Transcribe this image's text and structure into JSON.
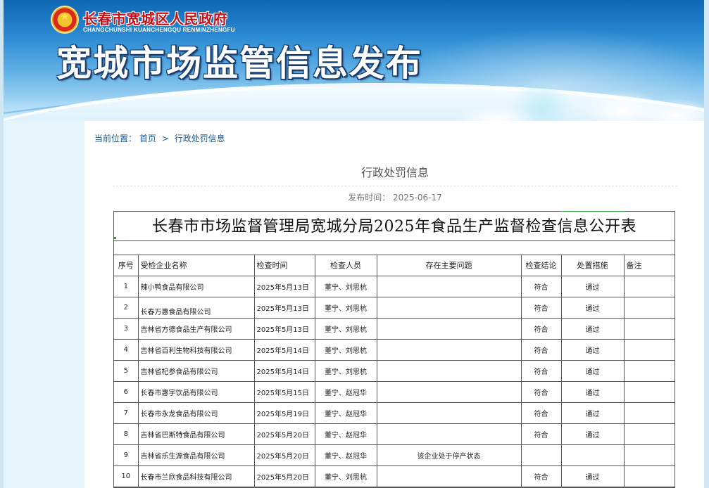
{
  "header": {
    "site_name": "长春市宽城区人民政府",
    "site_pinyin": "CHANGCHUNSHI KUANCHENGQU RENMINZHENGFU",
    "banner_title": "宽城市场监管信息发布"
  },
  "breadcrumb": {
    "prefix": "当前位置：",
    "home": "首页",
    "separator": ">",
    "current": "行政处罚信息"
  },
  "article": {
    "title": "行政处罚信息",
    "publish_time": "发布时间： 2025-06-17"
  },
  "table": {
    "title": "长春市市场监督管理局宽城分局2025年食品生产监督检查信息公开表",
    "headers": {
      "no": "序号",
      "company": "受检企业名称",
      "date": "检查时间",
      "inspectors": "检查人员",
      "problems": "存在主要问题",
      "conclusion": "检查结论",
      "measures": "处置措施",
      "remarks": "备注"
    },
    "rows": [
      {
        "no": "1",
        "company": "辣小鸭食品有限公司",
        "date": "2025年5月13日",
        "inspectors": "董宁、刘思杭",
        "problems": "",
        "conclusion": "符合",
        "measures": "通过",
        "remarks": ""
      },
      {
        "no": "2",
        "company": "长春万惠食品有限公司",
        "date": "2025年5月13日",
        "inspectors": "董宁、刘思杭",
        "problems": "",
        "conclusion": "符合",
        "measures": "通过",
        "remarks": ""
      },
      {
        "no": "3",
        "company": "吉林省方德食品生产有限公司",
        "date": "2025年5月13日",
        "inspectors": "董宁、刘思杭",
        "problems": "",
        "conclusion": "符合",
        "measures": "通过",
        "remarks": ""
      },
      {
        "no": "4",
        "company": "吉林省百利生物科技有限公司",
        "date": "2025年5月14日",
        "inspectors": "董宁、刘思杭",
        "problems": "",
        "conclusion": "符合",
        "measures": "通过",
        "remarks": ""
      },
      {
        "no": "5",
        "company": "吉林省杞参食品有限公司",
        "date": "2025年5月14日",
        "inspectors": "董宁、刘思杭",
        "problems": "",
        "conclusion": "符合",
        "measures": "通过",
        "remarks": ""
      },
      {
        "no": "6",
        "company": "长春市惠宇饮品有限公司",
        "date": "2025年5月15日",
        "inspectors": "董宁、赵冠华",
        "problems": "",
        "conclusion": "符合",
        "measures": "通过",
        "remarks": ""
      },
      {
        "no": "7",
        "company": "长春市永龙食品有限公司",
        "date": "2025年5月19日",
        "inspectors": "董宁、赵冠华",
        "problems": "",
        "conclusion": "符合",
        "measures": "通过",
        "remarks": ""
      },
      {
        "no": "8",
        "company": "吉林省巴斯特食品有限公司",
        "date": "2025年5月20日",
        "inspectors": "董宁、赵冠华",
        "problems": "",
        "conclusion": "符合",
        "measures": "通过",
        "remarks": ""
      },
      {
        "no": "9",
        "company": "吉林省乐生源食品有限公司",
        "date": "2025年5月20日",
        "inspectors": "董宁、赵冠华",
        "problems": "该企业处于停产状态",
        "conclusion": "",
        "measures": "",
        "remarks": ""
      },
      {
        "no": "10",
        "company": "长春市兰欣食品科技有限公司",
        "date": "2025年5月20日",
        "inspectors": "董宁、刘思杭",
        "problems": "",
        "conclusion": "符合",
        "measures": "通过",
        "remarks": ""
      }
    ]
  },
  "colors": {
    "banner_top": "#0f67b4",
    "site_name": "#c8101a",
    "link": "#1a5d99",
    "side_strip": "#e5f3fb"
  },
  "icons": {
    "emblem": "national-emblem-icon"
  }
}
